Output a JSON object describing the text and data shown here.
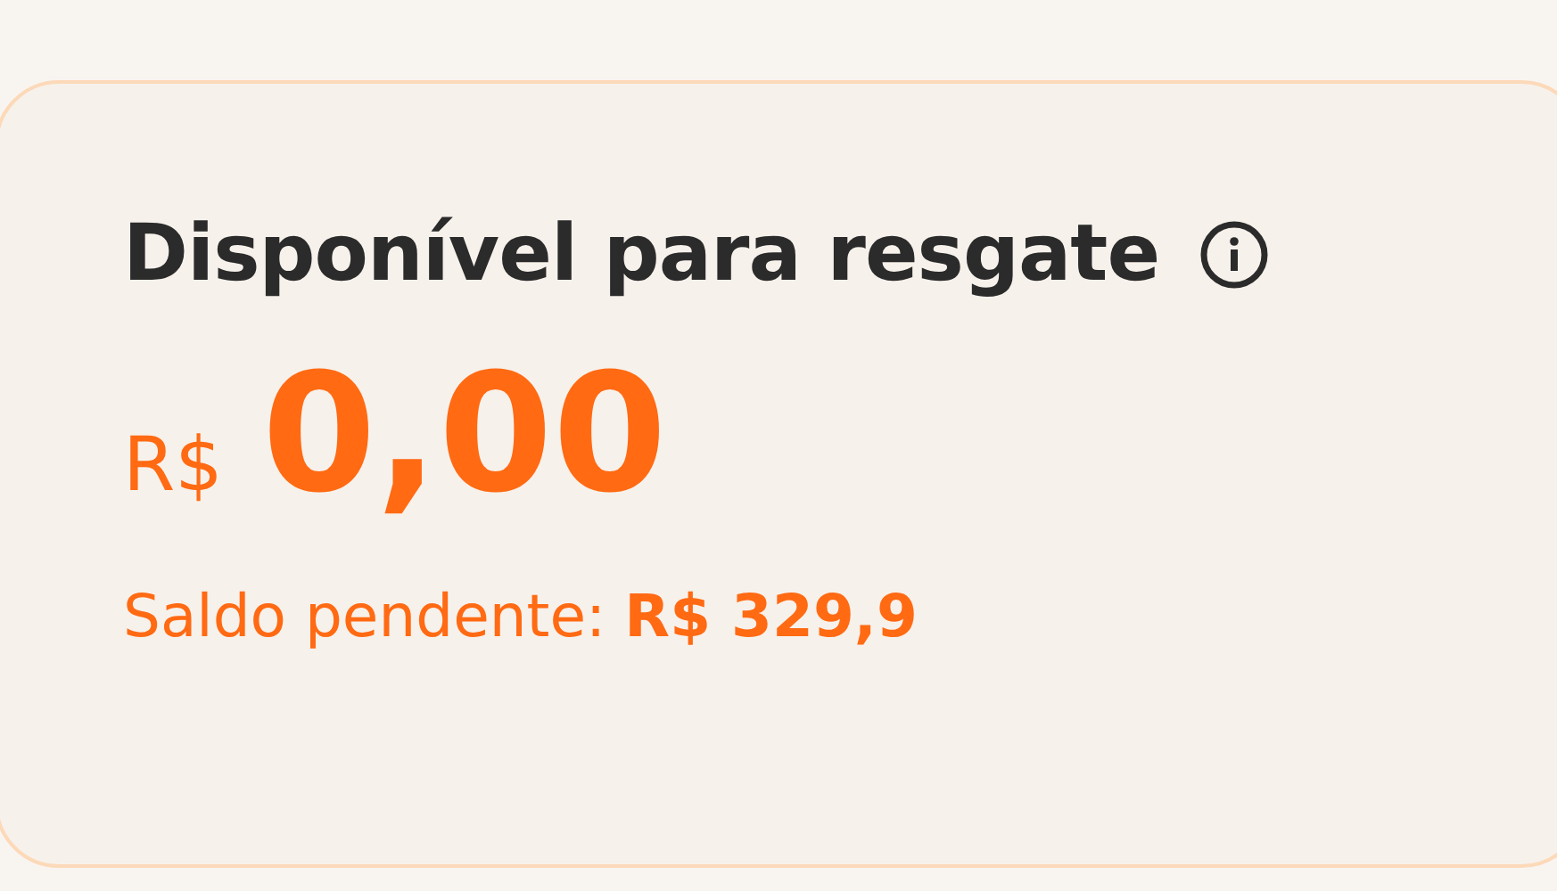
{
  "card": {
    "title": "Disponível para resgate",
    "balance": {
      "currency": "R$",
      "amount": "0,00"
    },
    "pending": "Saldo pendente: **R$ 329,9**"
  }
}
